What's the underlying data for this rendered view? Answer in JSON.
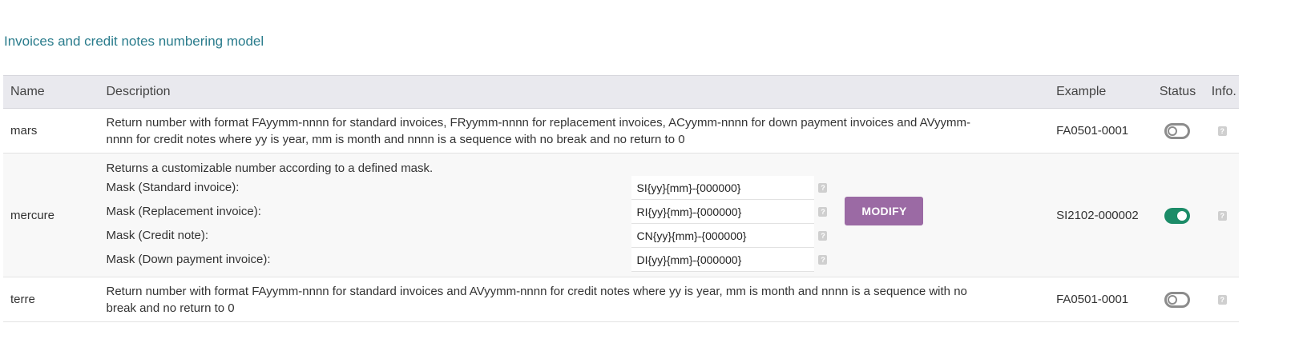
{
  "section_title": "Invoices and credit notes numbering model",
  "columns": {
    "name": "Name",
    "description": "Description",
    "example": "Example",
    "status": "Status",
    "info": "Info."
  },
  "rows": [
    {
      "name": "mars",
      "description_line1": "Return number with format FAyymm-nnnn for standard invoices, FRyymm-nnnn for replacement invoices, ACyymm-nnnn for down payment invoices and AVyymm-",
      "description_line2": "nnnn for credit notes where yy is year, mm is month and nnnn is a sequence with no break and no return to 0",
      "example": "FA0501-0001",
      "status": "off",
      "info_icon": "help-icon"
    },
    {
      "name": "mercure",
      "description": "Returns a customizable number according to a defined mask.",
      "masks": [
        {
          "label": "Mask (Standard invoice):",
          "value": "SI{yy}{mm}-{000000}"
        },
        {
          "label": "Mask (Replacement invoice):",
          "value": "RI{yy}{mm}-{000000}"
        },
        {
          "label": "Mask (Credit note):",
          "value": "CN{yy}{mm}-{000000}"
        },
        {
          "label": "Mask (Down payment invoice):",
          "value": "DI{yy}{mm}-{000000}"
        }
      ],
      "modify_label": "MODIFY",
      "example": "SI2102-000002",
      "status": "on",
      "info_icon": "help-icon"
    },
    {
      "name": "terre",
      "description_line1": "Return number with format FAyymm-nnnn for standard invoices and AVyymm-nnnn for credit notes where yy is year, mm is month and nnnn is a sequence with no",
      "description_line2": "break and no return to 0",
      "example": "FA0501-0001",
      "status": "off",
      "info_icon": "help-icon"
    }
  ],
  "colors": {
    "title": "#2a7c8c",
    "toggle_on": "#1c8c68",
    "toggle_off": "#8c8c8c",
    "modify_button": "#9b6aa4",
    "header_bg": "#e9e9ee"
  },
  "help_glyph": "?"
}
